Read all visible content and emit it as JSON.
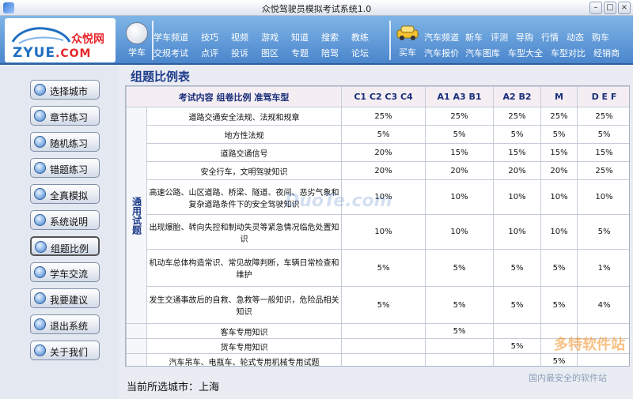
{
  "window": {
    "title": "众悦驾驶员模拟考试系统1.0"
  },
  "logo": {
    "en": "ZYUE",
    "com": ".COM",
    "cn": "众悦网"
  },
  "nav": {
    "xueche_label": "学车",
    "xueche_links": [
      "学车频道",
      "技巧",
      "视频",
      "游戏",
      "知道",
      "搜索",
      "教练",
      "交规考试",
      "点评",
      "投诉",
      "图区",
      "专题",
      "陪驾",
      "论坛"
    ],
    "maiche_label": "买车",
    "maiche_links": [
      "汽车频道",
      "新车",
      "评测",
      "导购",
      "行情",
      "动态",
      "购车",
      "汽车报价",
      "汽车图库",
      "车型大全",
      "车型对比",
      "经销商"
    ]
  },
  "sidebar": {
    "items": [
      {
        "label": "选择城市",
        "icon": "home-icon"
      },
      {
        "label": "章节练习",
        "icon": "book-icon"
      },
      {
        "label": "随机练习",
        "icon": "shuffle-icon"
      },
      {
        "label": "错题练习",
        "icon": "error-list-icon"
      },
      {
        "label": "全真模拟",
        "icon": "exam-icon"
      },
      {
        "label": "系统说明",
        "icon": "info-icon"
      },
      {
        "label": "组题比例",
        "icon": "globe-icon"
      },
      {
        "label": "学车交流",
        "icon": "chat-icon"
      },
      {
        "label": "我要建议",
        "icon": "suggest-icon"
      },
      {
        "label": "退出系统",
        "icon": "exit-icon"
      },
      {
        "label": "关于我们",
        "icon": "about-icon"
      }
    ]
  },
  "main": {
    "title": "组题比例表",
    "table": {
      "header": [
        "考试内容 组卷比例 准驾车型",
        "C1 C2 C3 C4",
        "A1 A3 B1",
        "A2 B2",
        "M",
        "D E F"
      ],
      "category": "通用试题",
      "general_rows": [
        {
          "content": "道路交通安全法规、法规和规章",
          "v": [
            "25%",
            "25%",
            "25%",
            "25%",
            "25%"
          ]
        },
        {
          "content": "地方性法规",
          "v": [
            "5%",
            "5%",
            "5%",
            "5%",
            "5%"
          ]
        },
        {
          "content": "道路交通信号",
          "v": [
            "20%",
            "15%",
            "15%",
            "15%",
            "15%"
          ]
        },
        {
          "content": "安全行车，文明驾驶知识",
          "v": [
            "20%",
            "20%",
            "20%",
            "20%",
            "25%"
          ]
        },
        {
          "content": "高速公路、山区道路、桥梁、隧道、夜间、恶劣气象和复杂道路条件下的安全驾驶知识",
          "v": [
            "10%",
            "10%",
            "10%",
            "10%",
            "10%"
          ]
        },
        {
          "content": "出现爆胎、转向失控和制动失灵等紧急情况临危处置知识",
          "v": [
            "10%",
            "10%",
            "10%",
            "10%",
            "5%"
          ]
        },
        {
          "content": "机动车总体构造常识、常见故障判断，车辆日常检查和维护",
          "v": [
            "5%",
            "5%",
            "5%",
            "5%",
            "1%"
          ]
        },
        {
          "content": "发生交通事故后的自救、急救等一般知识，危险品相关知识",
          "v": [
            "5%",
            "5%",
            "5%",
            "5%",
            "4%"
          ]
        }
      ],
      "special_rows": [
        {
          "content": "客车专用知识",
          "v": [
            "",
            "5%",
            "",
            "",
            ""
          ]
        },
        {
          "content": "货车专用知识",
          "v": [
            "",
            "",
            "5%",
            "",
            ""
          ]
        },
        {
          "content": "汽车吊车、电瓶车、轮式专用机械专用试题",
          "v": [
            "",
            "",
            "",
            "5%",
            ""
          ]
        }
      ]
    }
  },
  "status": {
    "text": "当前所选城市：上海"
  },
  "watermarks": {
    "w1": "DuoTe.com",
    "w2": "多特软件站",
    "w3": "国内最安全的软件站"
  }
}
